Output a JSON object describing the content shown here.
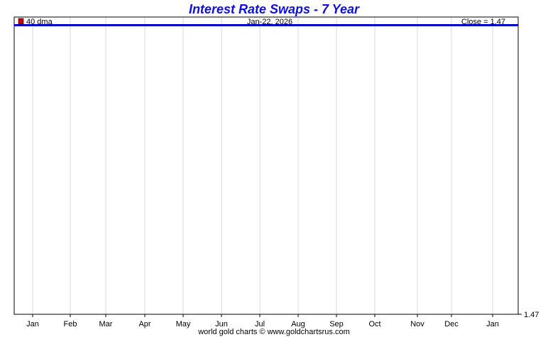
{
  "chart_data": {
    "type": "line",
    "title": "Interest Rate Swaps - 7 Year",
    "x_tick_labels": [
      "Jan",
      "Feb",
      "Mar",
      "Apr",
      "May",
      "Jun",
      "Jul",
      "Aug",
      "Sep",
      "Oct",
      "Nov",
      "Dec",
      "Jan"
    ],
    "y_tick_labels": [
      "1.47"
    ],
    "legend": {
      "label": "40 dma",
      "color": "#cc0000"
    },
    "date_label": "Jan-22, 2026",
    "close_label": "Close = 1.47",
    "series": [
      {
        "name": "40 dma",
        "color": "#0000cc",
        "values": [
          1.47,
          1.47,
          1.47,
          1.47,
          1.47,
          1.47,
          1.47,
          1.47,
          1.47,
          1.47,
          1.47,
          1.47,
          1.47
        ]
      }
    ],
    "grid": true,
    "footer": "world gold charts © www.goldchartsrus.com",
    "colors": {
      "title": "#1010dd",
      "series_line": "#0000cc",
      "grid": "#d8d8d8",
      "legend_box": "#cc0000"
    }
  }
}
